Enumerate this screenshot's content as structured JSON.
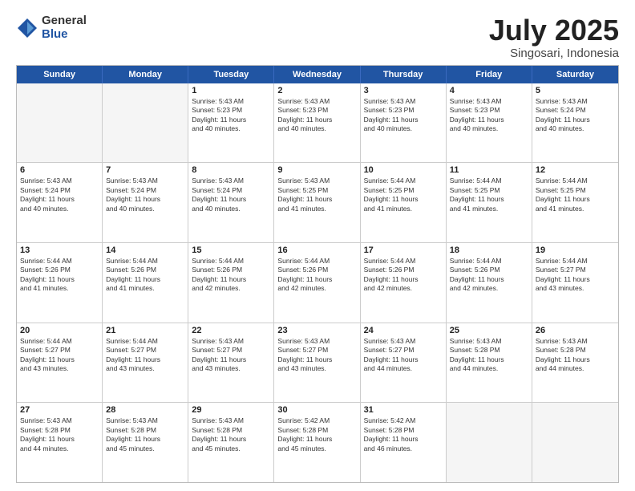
{
  "logo": {
    "general": "General",
    "blue": "Blue"
  },
  "title": {
    "month": "July 2025",
    "location": "Singosari, Indonesia"
  },
  "header": {
    "days": [
      "Sunday",
      "Monday",
      "Tuesday",
      "Wednesday",
      "Thursday",
      "Friday",
      "Saturday"
    ]
  },
  "weeks": [
    [
      {
        "date": "",
        "info": ""
      },
      {
        "date": "",
        "info": ""
      },
      {
        "date": "1",
        "info": "Sunrise: 5:43 AM\nSunset: 5:23 PM\nDaylight: 11 hours\nand 40 minutes."
      },
      {
        "date": "2",
        "info": "Sunrise: 5:43 AM\nSunset: 5:23 PM\nDaylight: 11 hours\nand 40 minutes."
      },
      {
        "date": "3",
        "info": "Sunrise: 5:43 AM\nSunset: 5:23 PM\nDaylight: 11 hours\nand 40 minutes."
      },
      {
        "date": "4",
        "info": "Sunrise: 5:43 AM\nSunset: 5:23 PM\nDaylight: 11 hours\nand 40 minutes."
      },
      {
        "date": "5",
        "info": "Sunrise: 5:43 AM\nSunset: 5:24 PM\nDaylight: 11 hours\nand 40 minutes."
      }
    ],
    [
      {
        "date": "6",
        "info": "Sunrise: 5:43 AM\nSunset: 5:24 PM\nDaylight: 11 hours\nand 40 minutes."
      },
      {
        "date": "7",
        "info": "Sunrise: 5:43 AM\nSunset: 5:24 PM\nDaylight: 11 hours\nand 40 minutes."
      },
      {
        "date": "8",
        "info": "Sunrise: 5:43 AM\nSunset: 5:24 PM\nDaylight: 11 hours\nand 40 minutes."
      },
      {
        "date": "9",
        "info": "Sunrise: 5:43 AM\nSunset: 5:25 PM\nDaylight: 11 hours\nand 41 minutes."
      },
      {
        "date": "10",
        "info": "Sunrise: 5:44 AM\nSunset: 5:25 PM\nDaylight: 11 hours\nand 41 minutes."
      },
      {
        "date": "11",
        "info": "Sunrise: 5:44 AM\nSunset: 5:25 PM\nDaylight: 11 hours\nand 41 minutes."
      },
      {
        "date": "12",
        "info": "Sunrise: 5:44 AM\nSunset: 5:25 PM\nDaylight: 11 hours\nand 41 minutes."
      }
    ],
    [
      {
        "date": "13",
        "info": "Sunrise: 5:44 AM\nSunset: 5:26 PM\nDaylight: 11 hours\nand 41 minutes."
      },
      {
        "date": "14",
        "info": "Sunrise: 5:44 AM\nSunset: 5:26 PM\nDaylight: 11 hours\nand 41 minutes."
      },
      {
        "date": "15",
        "info": "Sunrise: 5:44 AM\nSunset: 5:26 PM\nDaylight: 11 hours\nand 42 minutes."
      },
      {
        "date": "16",
        "info": "Sunrise: 5:44 AM\nSunset: 5:26 PM\nDaylight: 11 hours\nand 42 minutes."
      },
      {
        "date": "17",
        "info": "Sunrise: 5:44 AM\nSunset: 5:26 PM\nDaylight: 11 hours\nand 42 minutes."
      },
      {
        "date": "18",
        "info": "Sunrise: 5:44 AM\nSunset: 5:26 PM\nDaylight: 11 hours\nand 42 minutes."
      },
      {
        "date": "19",
        "info": "Sunrise: 5:44 AM\nSunset: 5:27 PM\nDaylight: 11 hours\nand 43 minutes."
      }
    ],
    [
      {
        "date": "20",
        "info": "Sunrise: 5:44 AM\nSunset: 5:27 PM\nDaylight: 11 hours\nand 43 minutes."
      },
      {
        "date": "21",
        "info": "Sunrise: 5:44 AM\nSunset: 5:27 PM\nDaylight: 11 hours\nand 43 minutes."
      },
      {
        "date": "22",
        "info": "Sunrise: 5:43 AM\nSunset: 5:27 PM\nDaylight: 11 hours\nand 43 minutes."
      },
      {
        "date": "23",
        "info": "Sunrise: 5:43 AM\nSunset: 5:27 PM\nDaylight: 11 hours\nand 43 minutes."
      },
      {
        "date": "24",
        "info": "Sunrise: 5:43 AM\nSunset: 5:27 PM\nDaylight: 11 hours\nand 44 minutes."
      },
      {
        "date": "25",
        "info": "Sunrise: 5:43 AM\nSunset: 5:28 PM\nDaylight: 11 hours\nand 44 minutes."
      },
      {
        "date": "26",
        "info": "Sunrise: 5:43 AM\nSunset: 5:28 PM\nDaylight: 11 hours\nand 44 minutes."
      }
    ],
    [
      {
        "date": "27",
        "info": "Sunrise: 5:43 AM\nSunset: 5:28 PM\nDaylight: 11 hours\nand 44 minutes."
      },
      {
        "date": "28",
        "info": "Sunrise: 5:43 AM\nSunset: 5:28 PM\nDaylight: 11 hours\nand 45 minutes."
      },
      {
        "date": "29",
        "info": "Sunrise: 5:43 AM\nSunset: 5:28 PM\nDaylight: 11 hours\nand 45 minutes."
      },
      {
        "date": "30",
        "info": "Sunrise: 5:42 AM\nSunset: 5:28 PM\nDaylight: 11 hours\nand 45 minutes."
      },
      {
        "date": "31",
        "info": "Sunrise: 5:42 AM\nSunset: 5:28 PM\nDaylight: 11 hours\nand 46 minutes."
      },
      {
        "date": "",
        "info": ""
      },
      {
        "date": "",
        "info": ""
      }
    ]
  ]
}
